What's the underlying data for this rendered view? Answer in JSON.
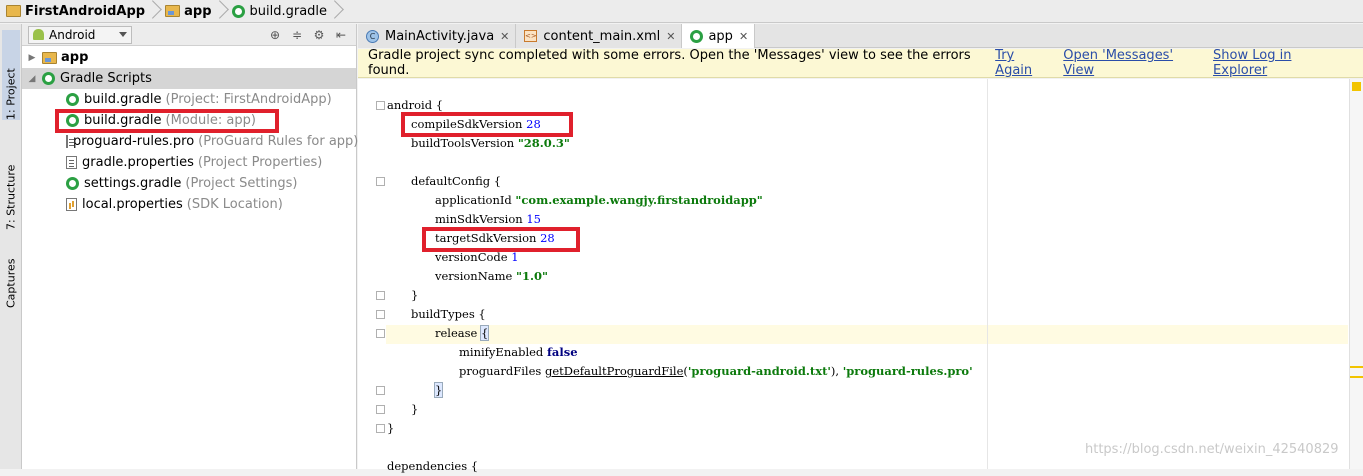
{
  "breadcrumb": {
    "project": "FirstAndroidApp",
    "module": "app",
    "file": "build.gradle"
  },
  "toolstrip": {
    "project_tab": "1: Project",
    "structure_tab": "7: Structure",
    "captures_tab": "Captures"
  },
  "project_panel": {
    "view_mode": "Android",
    "tree": [
      {
        "label": "app",
        "hint": ""
      },
      {
        "label": "Gradle Scripts",
        "hint": ""
      },
      {
        "label": "build.gradle",
        "hint": "(Project: FirstAndroidApp)"
      },
      {
        "label": "build.gradle",
        "hint": "(Module: app)"
      },
      {
        "label": "proguard-rules.pro",
        "hint": "(ProGuard Rules for app)"
      },
      {
        "label": "gradle.properties",
        "hint": "(Project Properties)"
      },
      {
        "label": "settings.gradle",
        "hint": "(Project Settings)"
      },
      {
        "label": "local.properties",
        "hint": "(SDK Location)"
      }
    ]
  },
  "tabs": [
    {
      "label": "MainActivity.java"
    },
    {
      "label": "content_main.xml"
    },
    {
      "label": "app"
    }
  ],
  "notice": {
    "message": "Gradle project sync completed with some errors. Open the 'Messages' view to see the errors found.",
    "try_again": "Try Again",
    "open_messages": "Open 'Messages' View",
    "show_log": "Show Log in Explorer"
  },
  "code": {
    "l1": "android {",
    "l2a": "compileSdkVersion ",
    "l2b": "28",
    "l3a": "buildToolsVersion ",
    "l3b": "\"28.0.3\"",
    "l5": "defaultConfig {",
    "l6a": "applicationId ",
    "l6b": "\"com.example.wangjy.firstandroidapp\"",
    "l7a": "minSdkVersion ",
    "l7b": "15",
    "l8a": "targetSdkVersion ",
    "l8b": "28",
    "l9a": "versionCode ",
    "l9b": "1",
    "l10a": "versionName ",
    "l10b": "\"1.0\"",
    "l11": "}",
    "l12": "buildTypes {",
    "l13a": "release ",
    "l13b": "{",
    "l14a": "minifyEnabled ",
    "l14b": "false",
    "l15a": "proguardFiles ",
    "l15b": "getDefaultProguardFile",
    "l15c": "(",
    "l15d": "'proguard-android.txt'",
    "l15e": "), ",
    "l15f": "'proguard-rules.pro'",
    "l16": "}",
    "l17": "}",
    "l18": "}",
    "l20": "dependencies {"
  },
  "watermark": "https://blog.csdn.net/weixin_42540829",
  "colors": {
    "highlight_box": "#e0202c",
    "notice_bg": "#fcf8d4",
    "link": "#2a4da8"
  }
}
